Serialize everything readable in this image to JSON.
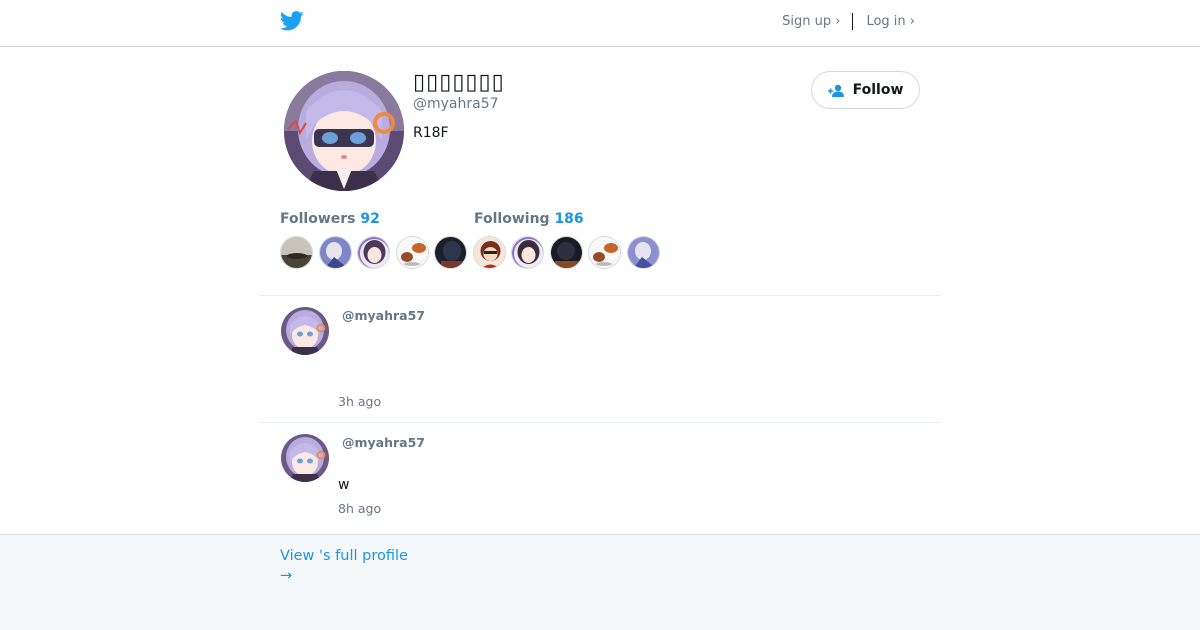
{
  "header": {
    "sign_up": "Sign up ›",
    "log_in": "Log in ›"
  },
  "profile": {
    "name": "▯▯▯▯▯▯▯",
    "handle": "@myahra57",
    "bio": "R18F",
    "follow_label": "Follow",
    "followers_label": "Followers",
    "followers_count": "92",
    "following_label": "Following",
    "following_count": "186"
  },
  "tweets": [
    {
      "user": "@myahra57",
      "text": "",
      "time": "3h ago"
    },
    {
      "user": "@myahra57",
      "text": "w",
      "time": "8h ago"
    }
  ],
  "footer": {
    "view_full_profile": "View 's full profile",
    "arrow": "→"
  },
  "colors": {
    "accent": "#1b95e0",
    "twitter_blue": "#1da1f2",
    "muted_text": "#657786",
    "footer_bg": "#f5f8fa"
  }
}
